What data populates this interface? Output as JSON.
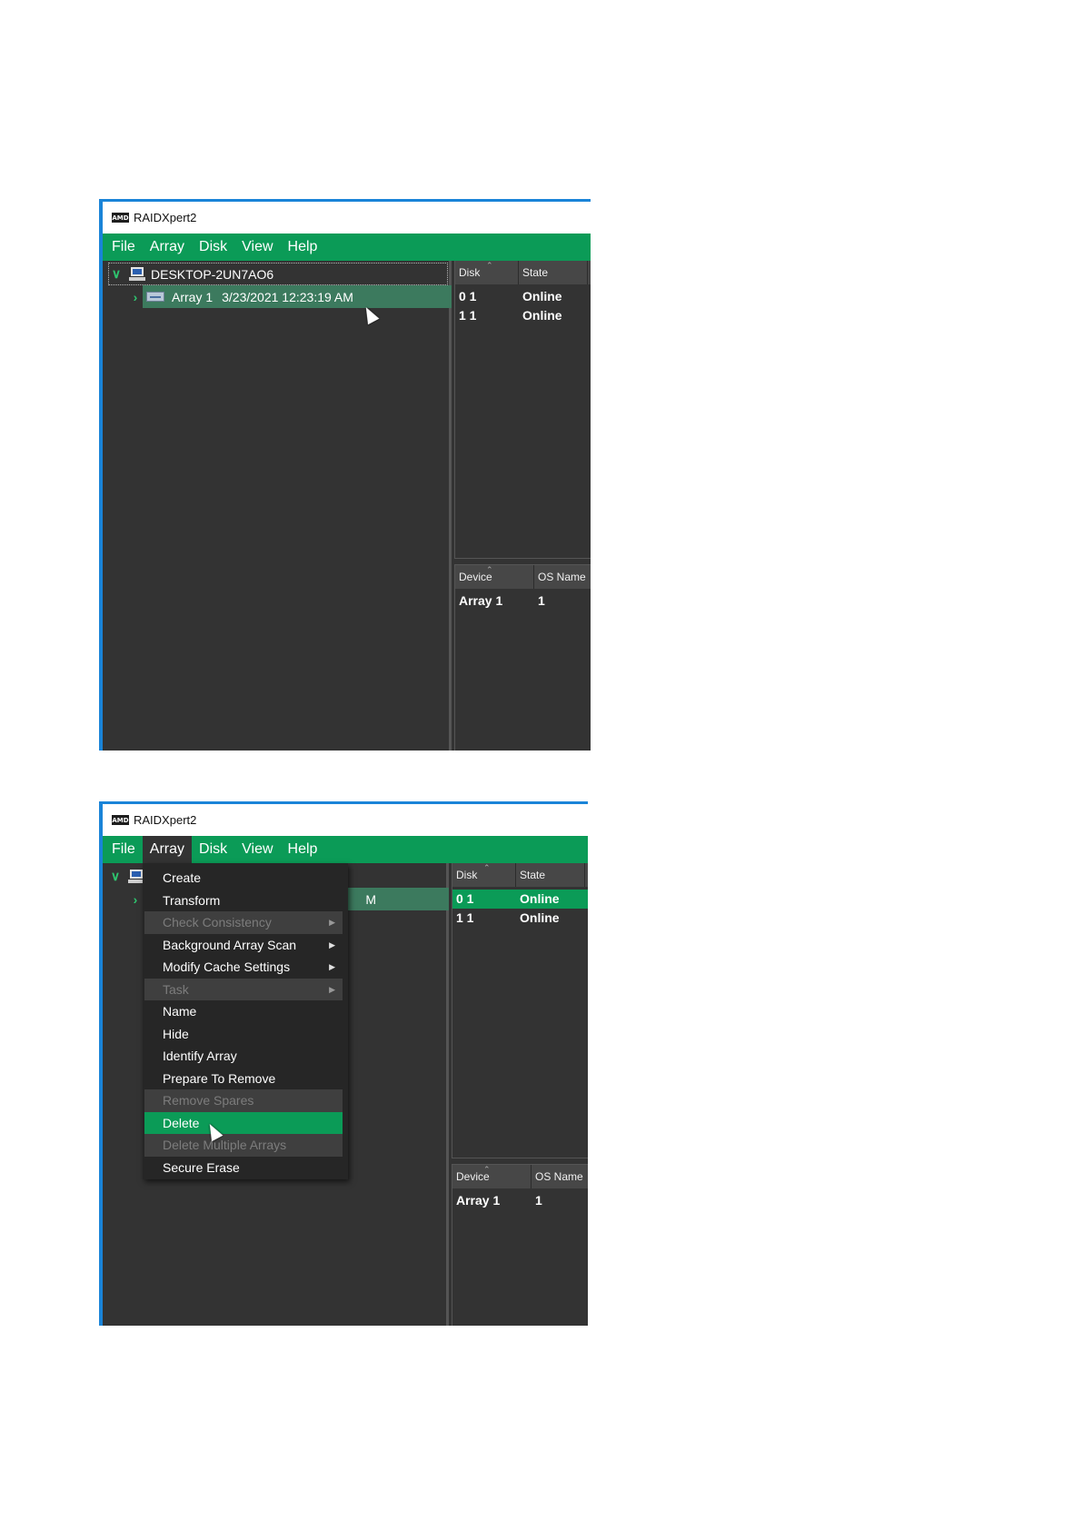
{
  "screenshot1": {
    "window_title": "RAIDXpert2",
    "logo_text": "AMD",
    "menu": [
      "File",
      "Array",
      "Disk",
      "View",
      "Help"
    ],
    "tree": {
      "host": "DESKTOP-2UN7AO6",
      "array_label": "Array 1",
      "array_date": "3/23/2021 12:23:19 AM"
    },
    "disk_panel": {
      "columns": [
        "Disk",
        "State"
      ],
      "rows": [
        [
          "0 1",
          "Online"
        ],
        [
          "1 1",
          "Online"
        ]
      ]
    },
    "device_panel": {
      "columns": [
        "Device",
        "OS Name"
      ],
      "rows": [
        [
          "Array 1",
          "1"
        ]
      ]
    }
  },
  "screenshot2": {
    "window_title": "RAIDXpert2",
    "logo_text": "AMD",
    "menu": [
      "File",
      "Array",
      "Disk",
      "View",
      "Help"
    ],
    "tree_fragment": "M",
    "array_menu": [
      {
        "label": "Create",
        "state": "enabled",
        "submenu": false
      },
      {
        "label": "Transform",
        "state": "enabled",
        "submenu": false
      },
      {
        "label": "Check Consistency",
        "state": "disabled",
        "submenu": true
      },
      {
        "label": "Background Array Scan",
        "state": "enabled",
        "submenu": true
      },
      {
        "label": "Modify Cache Settings",
        "state": "enabled",
        "submenu": true
      },
      {
        "label": "Task",
        "state": "disabled",
        "submenu": true
      },
      {
        "label": "Name",
        "state": "enabled",
        "submenu": false
      },
      {
        "label": "Hide",
        "state": "enabled",
        "submenu": false
      },
      {
        "label": "Identify Array",
        "state": "enabled",
        "submenu": false
      },
      {
        "label": "Prepare To Remove",
        "state": "enabled",
        "submenu": false
      },
      {
        "label": "Remove Spares",
        "state": "disabled",
        "submenu": false
      },
      {
        "label": "Delete",
        "state": "highlighted",
        "submenu": false
      },
      {
        "label": "Delete Multiple Arrays",
        "state": "disabled",
        "submenu": false
      },
      {
        "label": "Secure Erase",
        "state": "enabled",
        "submenu": false
      }
    ],
    "disk_panel": {
      "columns": [
        "Disk",
        "State"
      ],
      "rows": [
        [
          "0 1",
          "Online"
        ],
        [
          "1 1",
          "Online"
        ]
      ]
    },
    "device_panel": {
      "columns": [
        "Device",
        "OS Name"
      ],
      "rows": [
        [
          "Array 1",
          "1"
        ]
      ]
    }
  },
  "colors": {
    "accent_green": "#0b9b57",
    "panel_bg": "#333333",
    "window_border": "#1a84d8"
  }
}
